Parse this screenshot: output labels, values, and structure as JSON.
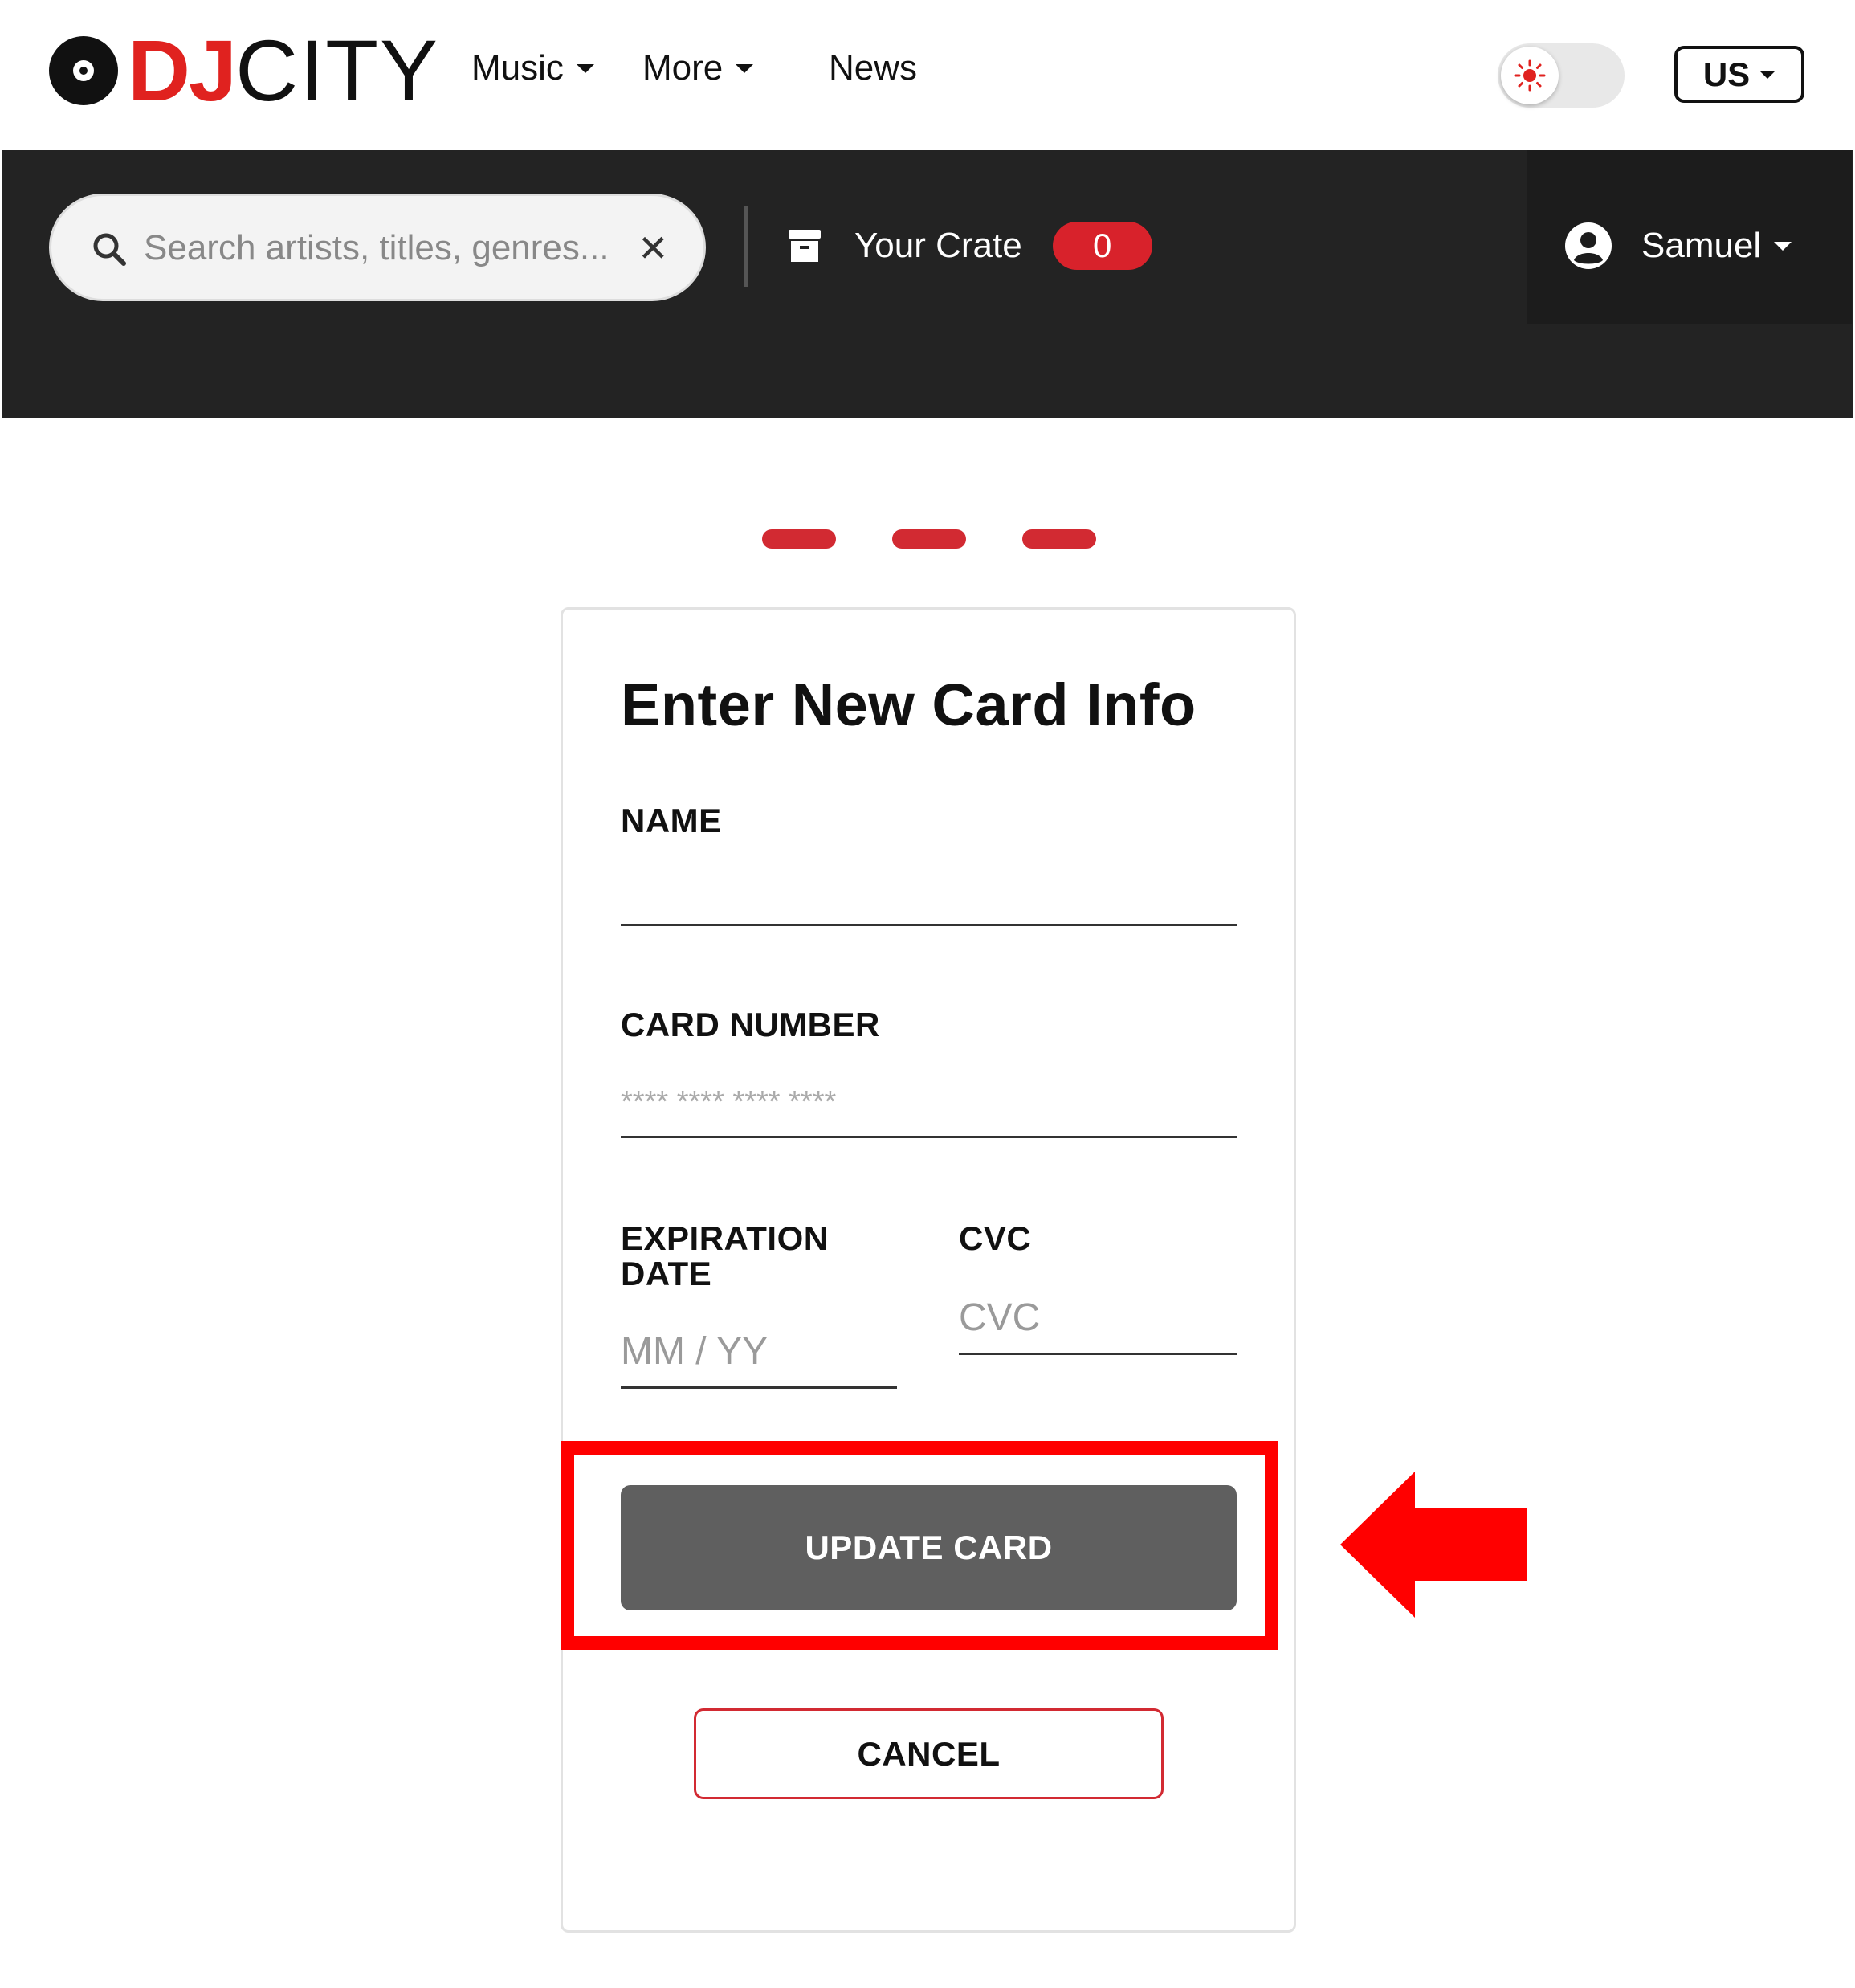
{
  "brand": {
    "part1": "DJ",
    "part2": "CITY"
  },
  "nav": {
    "items": [
      {
        "label": "Music",
        "has_caret": true
      },
      {
        "label": "More",
        "has_caret": true
      },
      {
        "label": "News",
        "has_caret": false
      }
    ],
    "theme_icon": "sun-icon",
    "region_label": "US"
  },
  "toolbar": {
    "search_placeholder": "Search artists, titles, genres...",
    "search_icon": "search-icon",
    "clear_icon": "close-icon",
    "crate_label": "Your Crate",
    "crate_count": "0",
    "user_name": "Samuel"
  },
  "steps": {
    "count": 3,
    "color": "#d22a32"
  },
  "form": {
    "title": "Enter New Card Info",
    "name_label": "NAME",
    "name_value": "",
    "card_number_label": "CARD NUMBER",
    "card_number_placeholder": "**** **** **** ****",
    "expiration_label": "EXPIRATION DATE",
    "expiration_placeholder": "MM / YY",
    "cvc_label": "CVC",
    "cvc_placeholder": "CVC",
    "update_button": "UPDATE CARD",
    "cancel_button": "CANCEL"
  },
  "colors": {
    "brand_red": "#e0221f",
    "header_dark": "#232323",
    "badge_red": "#d8222b",
    "update_button_gray": "#5f5f5f",
    "annotation_red": "#ff0000"
  }
}
